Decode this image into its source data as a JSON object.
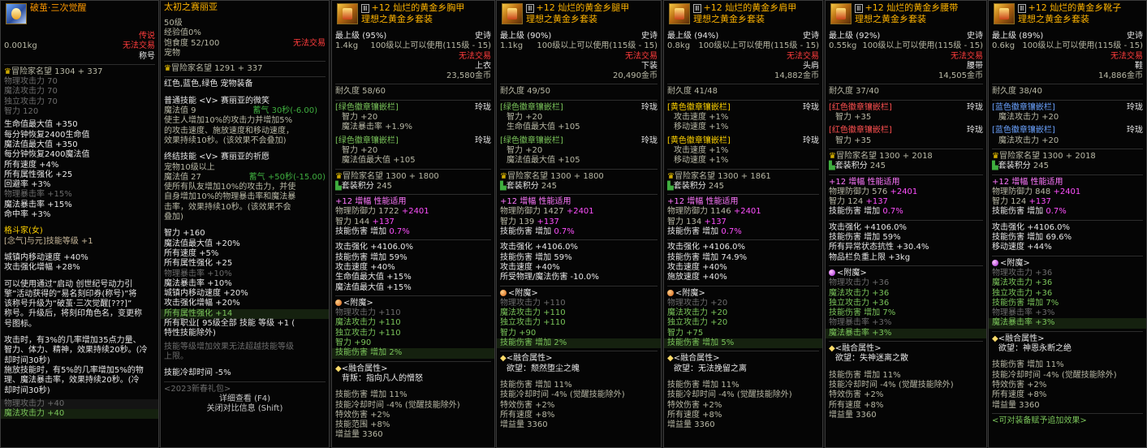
{
  "title_item": {
    "name": "破茧·三次觉醒",
    "weight": "0.001kg",
    "rarity": "传说",
    "trade": "无法交易",
    "type": "称号",
    "adventure": "冒险家名望",
    "adventure_val": "1304 + 337",
    "stats": [
      "物理攻击力 70",
      "魔法攻击力 70",
      "独立攻击力 70",
      "智力 120"
    ],
    "stats2": [
      "生命值最大值 +350",
      "每分钟恢复2400生命值",
      "魔法值最大值 +350",
      "每分钟恢复2400魔法值",
      "所有速度 +4%",
      "所有属性强化 +25",
      "回避率 +3%",
      "物理暴击率 +15%",
      "魔法暴击率 +15%",
      "命中率 +3%"
    ],
    "job": "格斗家(女)",
    "job_skill": "[念气]与元]技能等级 +1",
    "move": [
      "城镇内移动速度 +40%",
      "攻击强化增幅 +28%"
    ],
    "desc1": [
      "可以使用通过“启动 创世纪号动力引",
      "擎”活动获得的“易名刻印券(称号)”将",
      "该称号升级为“破茧·三次觉醒[???]”",
      "称号。升级后，将刻印角色名，变更称",
      "号图标。"
    ],
    "desc2": [
      "攻击时，有3%的几率增加35点力量、",
      "智力、体力、精神，效果持续20秒。(冷",
      "却时间30秒)",
      "施放技能时，有5%的几率增加5%的物",
      "理、魔法暴击率，效果持续20秒。(冷",
      "却时间30秒)"
    ],
    "bottom": [
      "物理攻击力 +40",
      "魔法攻击力 +40"
    ]
  },
  "pet": {
    "name": "太初之赛丽亚",
    "level": "50级",
    "exp": "经验值0%",
    "food": "饱食度 52/100",
    "trade": "无法交易",
    "type": "宠物",
    "adventure": "冒险家名望",
    "adventure_val": "1291 + 337",
    "equip": "红色,蓝色,绿色 宠物装备",
    "skill1_title": "普通技能 <V> 赛丽亚的微笑",
    "skill1_mp": "魔法值 9",
    "skill1_cd": "蓄气 30秒(-6.00)",
    "skill1_desc": [
      "使主人增加10%的攻击力并增加5%",
      "的攻击速度、施放速度和移动速度，",
      "效果持续10秒。(该效果不会叠加)"
    ],
    "skill2_title": "终结技能 <V> 赛丽亚的祈愿",
    "skill2_req": "宠物10级以上",
    "skill2_mp": "魔法值 27",
    "skill2_cd": "蓄气 +50秒(-15.00)",
    "skill2_desc": [
      "使所有队友增加10%的攻击力，并使",
      "自身增加10%的物理暴击率和魔法暴",
      "击率，效果持续10秒。(该效果不会",
      "叠加)"
    ],
    "stats": [
      "智力 +160",
      "魔法值最大值 +20%",
      "所有速度 +5%",
      "所有属性强化 +25",
      "物理暴击率 +10%",
      "魔法暴击率 +10%",
      "城镇内移动速度 +20%",
      "攻击强化增幅 +20%",
      "所有属性强化 +14",
      "所有职业[ 95级全部 技能 等级 +1 (",
      "特性技能除外)"
    ],
    "note": [
      "技能等级增加效果无法超越技能等级",
      "上限。"
    ],
    "cd": "技能冷却时间 -5%",
    "pack": "<2023新春礼包>",
    "btn1": "详细查看 (F4)",
    "btn2": "关闭对比信息 (Shift)"
  },
  "armors": [
    {
      "name": "+12 灿烂的黄金乡胸甲",
      "set": "理想之黄金乡套装",
      "grade": "最上级",
      "pct": "(95%)",
      "rarity": "史诗",
      "weight": "1.4kg",
      "req": "100级以上可以使用(115级 - 15)",
      "trade": "无法交易",
      "slot": "上衣",
      "price": "23,580金币",
      "dura": "耐久度 58/60",
      "emblem1_title": "[绿色徽章镶嵌栏]",
      "emblem1_tag": "玲珑",
      "emblem1": [
        "智力 +20",
        "魔法暴击率 +1.9%"
      ],
      "emblem2_title": "[绿色徽章镶嵌栏]",
      "emblem2_tag": "玲珑",
      "emblem2": [
        "智力 +20",
        "魔法值最大值 +105"
      ],
      "adventure": "冒险家名望",
      "adventure_val": "1300 + 1800",
      "setpts": "套装积分",
      "setpts_val": "245",
      "amp": "+12  增幅  性能适用",
      "def": "物理防御力 1722",
      "def_add": "+2401",
      "int": "智力 144",
      "int_add": "+137",
      "skill_dmg": "技能伤害  增加",
      "skill_dmg_val": "0.7%",
      "attrs": [
        "攻击强化 +4106.0%",
        "技能伤害 增加 59%",
        "攻击速度 +40%",
        "生命值最大值 +15%",
        "魔法值最大值 +15%"
      ],
      "ench_title": "<附魔>",
      "ench_gray": "物理攻击力 +110",
      "ench": [
        "魔法攻击力 +110",
        "独立攻击力 +110",
        "智力 +90"
      ],
      "ench_last": "技能伤害 增加",
      "ench_last_val": "2%",
      "fuse": "<融合属性>",
      "fuse_name": "背叛：指向凡人的憎怒",
      "fuse_stats": [
        "技能伤害 增加 11%",
        "技能冷却时间 -4% (觉醒技能除外)",
        "特效伤害 +2%",
        "技能范围 +8%",
        "增益量 3360"
      ]
    },
    {
      "name": "+12 灿烂的黄金乡腿甲",
      "set": "理想之黄金乡套装",
      "grade": "最上级",
      "pct": "(90%)",
      "rarity": "史诗",
      "weight": "1.1kg",
      "req": "100级以上可以使用(115级 - 15)",
      "trade": "无法交易",
      "slot": "下装",
      "price": "20,490金币",
      "dura": "耐久度 49/50",
      "emblem1_title": "[绿色徽章镶嵌栏]",
      "emblem1_tag": "玲珑",
      "emblem1": [
        "智力 +20",
        "生命值最大值 +105"
      ],
      "emblem2_title": "[绿色徽章镶嵌栏]",
      "emblem2_tag": "玲珑",
      "emblem2": [
        "智力 +20",
        "魔法值最大值 +105"
      ],
      "adventure": "冒险家名望",
      "adventure_val": "1300 + 1800",
      "setpts": "套装积分",
      "setpts_val": "245",
      "amp": "+12  增幅  性能适用",
      "def": "物理防御力 1427",
      "def_add": "+2401",
      "int": "智力 139",
      "int_add": "+137",
      "skill_dmg": "技能伤害  增加",
      "skill_dmg_val": "0.7%",
      "attrs": [
        "攻击强化 +4106.0%",
        "技能伤害 增加 59%",
        "攻击速度 +40%",
        "所受物理/魔法伤害 -10.0%"
      ],
      "ench_title": "<附魔>",
      "ench_gray": "物理攻击力 +110",
      "ench": [
        "魔法攻击力 +110",
        "独立攻击力 +110",
        "智力 +90"
      ],
      "ench_last": "技能伤害 增加",
      "ench_last_val": "2%",
      "fuse": "<融合属性>",
      "fuse_name": "欲望：颓然堕尘之魄",
      "fuse_stats": [
        "技能伤害 增加 11%",
        "技能冷却时间 -4% (觉醒技能除外)",
        "特效伤害 +2%",
        "所有速度 +8%",
        "增益量 3360"
      ]
    },
    {
      "name": "+12 灿烂的黄金乡肩甲",
      "set": "理想之黄金乡套装",
      "grade": "最上级",
      "pct": "(94%)",
      "rarity": "史诗",
      "weight": "0.8kg",
      "req": "100级以上可以使用(115级 - 15)",
      "trade": "无法交易",
      "slot": "头肩",
      "price": "14,882金币",
      "dura": "耐久度 41/48",
      "emblem1_title": "[黄色徽章镶嵌栏]",
      "emblem1_tag": "玲珑",
      "emblem1": [
        "攻击速度 +1%",
        "移动速度 +1%"
      ],
      "emblem2_title": "[黄色徽章镶嵌栏]",
      "emblem2_tag": "玲珑",
      "emblem2": [
        "攻击速度 +1%",
        "移动速度 +1%"
      ],
      "adventure": "冒险家名望",
      "adventure_val": "1300 + 1861",
      "setpts": "套装积分",
      "setpts_val": "245",
      "amp": "+12  增幅  性能适用",
      "def": "物理防御力 1146",
      "def_add": "+2401",
      "int": "智力 134",
      "int_add": "+137",
      "skill_dmg": "技能伤害  增加",
      "skill_dmg_val": "0.7%",
      "attrs": [
        "攻击强化 +4106.0%",
        "技能伤害 增加 74.9%",
        "攻击速度 +40%",
        "施放速度 +40%"
      ],
      "ench_title": "<附魔>",
      "ench_gray": "物理攻击力 +20",
      "ench": [
        "魔法攻击力 +20",
        "独立攻击力 +20",
        "智力 +75"
      ],
      "ench_last": "技能伤害 增加",
      "ench_last_val": "5%",
      "fuse": "<融合属性>",
      "fuse_name": "欲望：无法挽留之离",
      "fuse_stats": [
        "技能伤害 增加 11%",
        "技能冷却时间 -4% (觉醒技能除外)",
        "特效伤害 +2%",
        "所有速度 +8%",
        "增益量 3360"
      ]
    },
    {
      "name": "+12 灿烂的黄金乡腰带",
      "set": "理想之黄金乡套装",
      "grade": "最上级",
      "pct": "(92%)",
      "rarity": "史诗",
      "weight": "0.55kg",
      "req": "100级以上可以使用(115级 - 15)",
      "trade": "无法交易",
      "slot": "腰带",
      "price": "14,505金币",
      "dura": "耐久度 37/40",
      "emblem1_title": "[红色徽章镶嵌栏]",
      "emblem1_tag": "玲珑",
      "emblem1": [
        "智力 +35"
      ],
      "emblem2_title": "[红色徽章镶嵌栏]",
      "emblem2_tag": "玲珑",
      "emblem2": [
        "智力 +35"
      ],
      "adventure": "冒险家名望",
      "adventure_val": "1300 + 2018",
      "setpts": "套装积分",
      "setpts_val": "245",
      "amp": "+12  增幅  性能适用",
      "def": "物理防御力 576",
      "def_add": "+2401",
      "int": "智力 124",
      "int_add": "+137",
      "skill_dmg": "技能伤害  增加",
      "skill_dmg_val": "0.7%",
      "attrs": [
        "攻击强化 +4106.0%",
        "技能伤害 增加 59%",
        "所有异常状态抗性 +30.4%",
        "物品栏负重上限 +3kg"
      ],
      "ench_title": "<附魔>",
      "ench_gray": "物理攻击力 +36",
      "ench": [
        "魔法攻击力 +36",
        "独立攻击力 +36",
        "技能伤害 增加 7%"
      ],
      "ench_gray2": "物理暴击率 +3%",
      "ench_last": "魔法暴击率 +3%",
      "ench_last_val": "",
      "fuse": "<融合属性>",
      "fuse_name": "欲望：失神迷离之散",
      "fuse_stats": [
        "技能伤害 增加 11%",
        "技能冷却时间 -4% (觉醒技能除外)",
        "特效伤害 +2%",
        "所有速度 +8%",
        "增益量 3360"
      ]
    },
    {
      "name": "+12 灿烂的黄金乡靴子",
      "set": "理想之黄金乡套装",
      "grade": "最上级",
      "pct": "(89%)",
      "rarity": "史诗",
      "weight": "0.6kg",
      "req": "100级以上可以使用(115级 - 15)",
      "trade": "无法交易",
      "slot": "鞋",
      "price": "14,886金币",
      "dura": "耐久度 38/40",
      "emblem1_title": "[蓝色徽章镶嵌栏]",
      "emblem1_tag": "玲珑",
      "emblem1": [
        "魔法攻击力 +20"
      ],
      "emblem2_title": "[蓝色徽章镶嵌栏]",
      "emblem2_tag": "玲珑",
      "emblem2": [
        "魔法攻击力 +20"
      ],
      "adventure": "冒险家名望",
      "adventure_val": "1300 + 2018",
      "setpts": "套装积分",
      "setpts_val": "245",
      "amp": "+12  增幅  性能适用",
      "def": "物理防御力 848",
      "def_add": "+2401",
      "int": "智力 124",
      "int_add": "+137",
      "skill_dmg": "技能伤害  增加",
      "skill_dmg_val": "0.7%",
      "attrs": [
        "攻击强化 +4106.0%",
        "技能伤害 增加 69.6%",
        "移动速度 +44%"
      ],
      "ench_title": "<附魔>",
      "ench_gray": "物理攻击力 +36",
      "ench": [
        "魔法攻击力 +36",
        "独立攻击力 +36",
        "技能伤害 增加 7%"
      ],
      "ench_gray2": "物理暴击率 +3%",
      "ench_last": "魔法暴击率 +3%",
      "ench_last_val": "",
      "fuse": "<融合属性>",
      "fuse_name": "欲望：神恩永断之绝",
      "fuse_stats": [
        "技能伤害 增加 11%",
        "技能冷却时间 -4% (觉醒技能除外)",
        "特效伤害 +2%",
        "所有速度 +8%",
        "增益量 3360"
      ],
      "footer": "<可对装备赋予追加效果>"
    }
  ],
  "colors": {
    "title": "#ffb400",
    "epic": "#ffb400",
    "trade": "#ff3c3c",
    "green": "#7ac55a",
    "pink": "#ff78ff"
  }
}
